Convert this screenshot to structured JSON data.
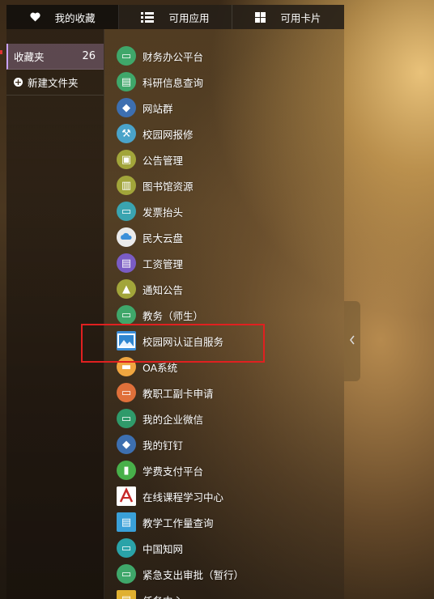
{
  "tabs": [
    {
      "label": "我的收藏",
      "icon": "heart-icon"
    },
    {
      "label": "可用应用",
      "icon": "list-icon"
    },
    {
      "label": "可用卡片",
      "icon": "grid-icon"
    }
  ],
  "sidebar": {
    "favorites_label": "收藏夹",
    "favorites_count": "26",
    "new_folder_label": "新建文件夹"
  },
  "apps": [
    {
      "label": "财务办公平台",
      "icon": "finance-icon",
      "color": "#3fa76a"
    },
    {
      "label": "科研信息查询",
      "icon": "research-icon",
      "color": "#3fa76a"
    },
    {
      "label": "网站群",
      "icon": "cube-icon",
      "color": "#3d6fb0"
    },
    {
      "label": "校园网报修",
      "icon": "repair-icon",
      "color": "#4aa3c9"
    },
    {
      "label": "公告管理",
      "icon": "board-icon",
      "color": "#a2a53a"
    },
    {
      "label": "图书馆资源",
      "icon": "books-icon",
      "color": "#a2a53a"
    },
    {
      "label": "发票抬头",
      "icon": "monitor-icon",
      "color": "#3aa4b0"
    },
    {
      "label": "民大云盘",
      "icon": "cloud-icon",
      "color": "#e8e8e8"
    },
    {
      "label": "工资管理",
      "icon": "wallet-icon",
      "color": "#7a5cc4"
    },
    {
      "label": "通知公告",
      "icon": "notice-icon",
      "color": "#a2a53a"
    },
    {
      "label": "教务（师生）",
      "icon": "teaching-icon",
      "color": "#3fa76a"
    },
    {
      "label": "校园网认证自服务",
      "icon": "image-icon",
      "color": "#3b8fd9"
    },
    {
      "label": "OA系统",
      "icon": "oa-icon",
      "color": "#f0a640"
    },
    {
      "label": "教职工副卡申请",
      "icon": "card-icon",
      "color": "#e0703a"
    },
    {
      "label": "我的企业微信",
      "icon": "wechat-work-icon",
      "color": "#2f9a6a"
    },
    {
      "label": "我的钉钉",
      "icon": "dingtalk-icon",
      "color": "#3d6fb0"
    },
    {
      "label": "学费支付平台",
      "icon": "payment-icon",
      "color": "#48b04a"
    },
    {
      "label": "在线课程学习中心",
      "icon": "course-icon",
      "color": "#ffffff"
    },
    {
      "label": "教学工作量查询",
      "icon": "document-icon",
      "color": "#3aa0d8"
    },
    {
      "label": "中国知网",
      "icon": "cnki-icon",
      "color": "#2aa3a8"
    },
    {
      "label": "紧急支出审批（暂行）",
      "icon": "approval-icon",
      "color": "#3fa76a"
    },
    {
      "label": "任务中心",
      "icon": "task-icon",
      "color": "#e0b030"
    }
  ]
}
